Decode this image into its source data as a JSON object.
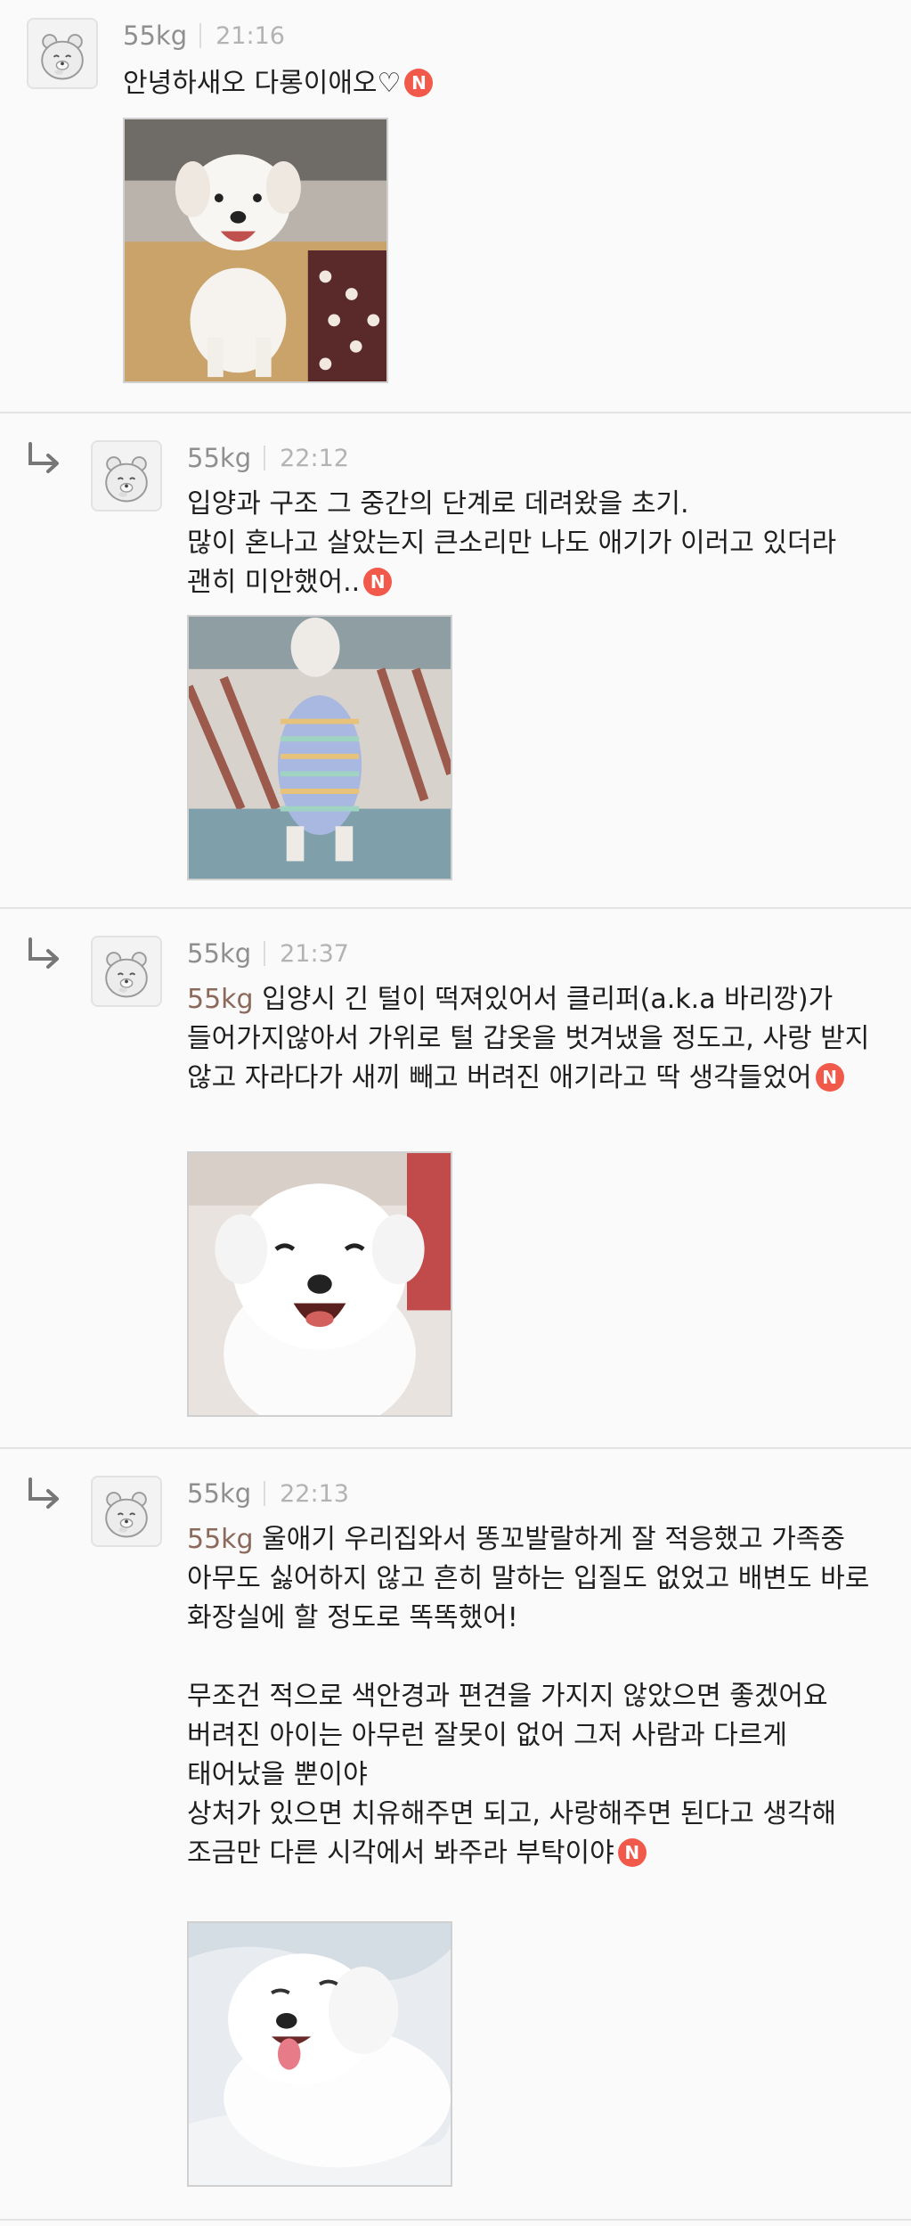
{
  "comments": [
    {
      "author": "55kg",
      "time": "21:16",
      "is_reply": false,
      "mention": "",
      "text": "안녕하새오 다롱이애오♡",
      "badge": "N",
      "photo_icon": "dog-photo-sitting-on-bed"
    },
    {
      "author": "55kg",
      "time": "22:12",
      "is_reply": true,
      "mention": "",
      "text": "입양과 구조 그 중간의 단계로 데려왔을 초기.\n많이 혼나고 살았는지 큰소리만 나도 애기가 이러고 있더라 괜히 미안했어..",
      "badge": "N",
      "photo_icon": "dog-photo-standing-in-sweater"
    },
    {
      "author": "55kg",
      "time": "21:37",
      "is_reply": true,
      "mention": "55kg",
      "text": " 입양시 긴 털이 떡져있어서 클리퍼(a.k.a 바리깡)가 들어가지않아서 가위로 털 갑옷을 벗겨냈을 정도고, 사랑 받지 않고 자라다가 새끼 빼고 버려진 애기라고 딱 생각들었어",
      "badge": "N",
      "photo_icon": "dog-photo-smiling-closeup"
    },
    {
      "author": "55kg",
      "time": "22:13",
      "is_reply": true,
      "mention": "55kg",
      "text": " 울애기 우리집와서 똥꼬발랄하게 잘 적응했고 가족중 아무도 싫어하지 않고 흔히 말하는 입질도 없었고 배변도 바로 화장실에 할 정도로 똑똑했어!\n\n무조건 적으로 색안경과 편견을 가지지 않았으면 좋겠어요\n버려진 아이는 아무런 잘못이 없어 그저 사람과 다르게 태어났을 뿐이야\n상처가 있으면 치유해주면 되고, 사랑해주면 된다고 생각해\n조금만 다른 시각에서 봐주라 부탁이야",
      "badge": "N",
      "photo_icon": "dog-photo-lying-tongue-out"
    }
  ]
}
